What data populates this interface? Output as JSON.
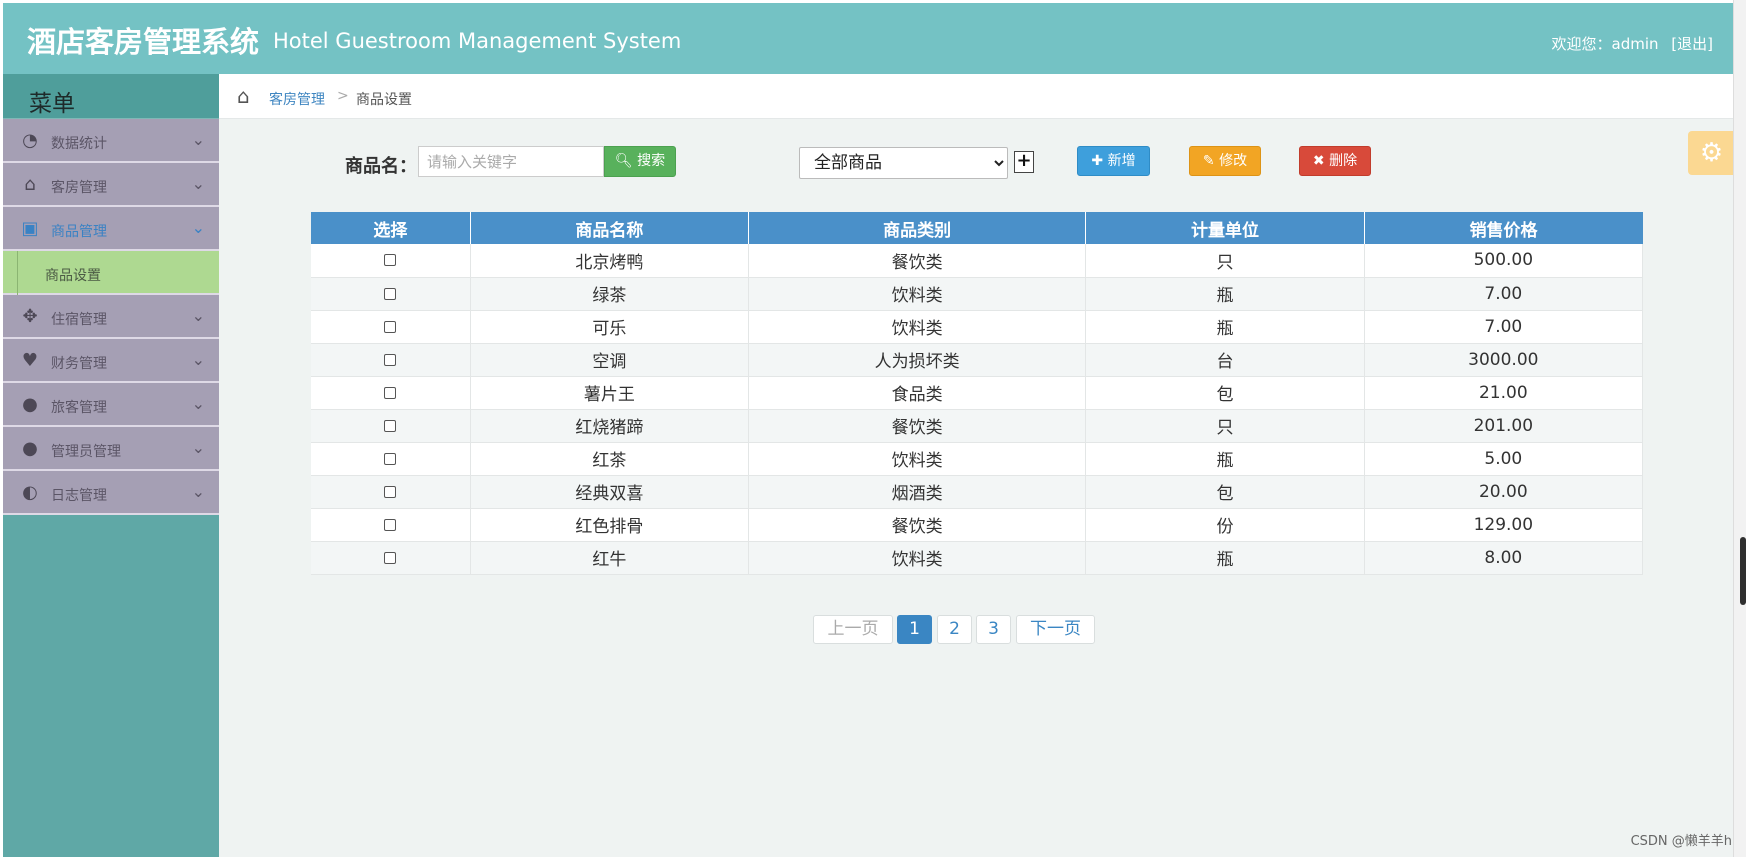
{
  "header": {
    "title": "酒店客房管理系统",
    "subtitle": "Hotel Guestroom Management System",
    "welcome": "欢迎您：admin",
    "logout": "[退出]"
  },
  "sidebar": {
    "menu_title": "菜单",
    "items": [
      {
        "label": "数据统计",
        "icon": "dashboard-icon"
      },
      {
        "label": "客房管理",
        "icon": "home-icon"
      },
      {
        "label": "商品管理",
        "icon": "beverage-icon"
      },
      {
        "label": "住宿管理",
        "icon": "move-icon"
      },
      {
        "label": "财务管理",
        "icon": "heart-icon"
      },
      {
        "label": "旅客管理",
        "icon": "user-icon"
      },
      {
        "label": "管理员管理",
        "icon": "user-icon"
      },
      {
        "label": "日志管理",
        "icon": "half-circle-icon"
      }
    ],
    "sub_item": "商品设置"
  },
  "breadcrumb": {
    "parent": "客房管理",
    "separator": ">",
    "current": "商品设置"
  },
  "search": {
    "label": "商品名：",
    "placeholder": "请输入关键字",
    "button": "搜索"
  },
  "filter": {
    "selected": "全部商品",
    "plus": "+"
  },
  "actions": {
    "add": "新增",
    "edit": "修改",
    "delete": "删除"
  },
  "table": {
    "columns": [
      "选择",
      "商品名称",
      "商品类别",
      "计量单位",
      "销售价格"
    ],
    "rows": [
      {
        "name": "北京烤鸭",
        "category": "餐饮类",
        "unit": "只",
        "price": "500.00"
      },
      {
        "name": "绿茶",
        "category": "饮料类",
        "unit": "瓶",
        "price": "7.00"
      },
      {
        "name": "可乐",
        "category": "饮料类",
        "unit": "瓶",
        "price": "7.00"
      },
      {
        "name": "空调",
        "category": "人为损坏类",
        "unit": "台",
        "price": "3000.00"
      },
      {
        "name": "薯片王",
        "category": "食品类",
        "unit": "包",
        "price": "21.00"
      },
      {
        "name": "红烧猪蹄",
        "category": "餐饮类",
        "unit": "只",
        "price": "201.00"
      },
      {
        "name": "红茶",
        "category": "饮料类",
        "unit": "瓶",
        "price": "5.00"
      },
      {
        "name": "经典双喜",
        "category": "烟酒类",
        "unit": "包",
        "price": "20.00"
      },
      {
        "name": "红色排骨",
        "category": "餐饮类",
        "unit": "份",
        "price": "129.00"
      },
      {
        "name": "红牛",
        "category": "饮料类",
        "unit": "瓶",
        "price": "8.00"
      }
    ]
  },
  "pagination": {
    "prev": "上一页",
    "pages": [
      "1",
      "2",
      "3"
    ],
    "current": "1",
    "next": "下一页"
  },
  "watermark": "CSDN @懒羊羊h",
  "colors": {
    "header": "#74c2c4",
    "table_header": "#4a90c9",
    "add": "#3e9fdc",
    "edit": "#f2a524",
    "delete": "#d84a3a",
    "search": "#58b15c"
  }
}
